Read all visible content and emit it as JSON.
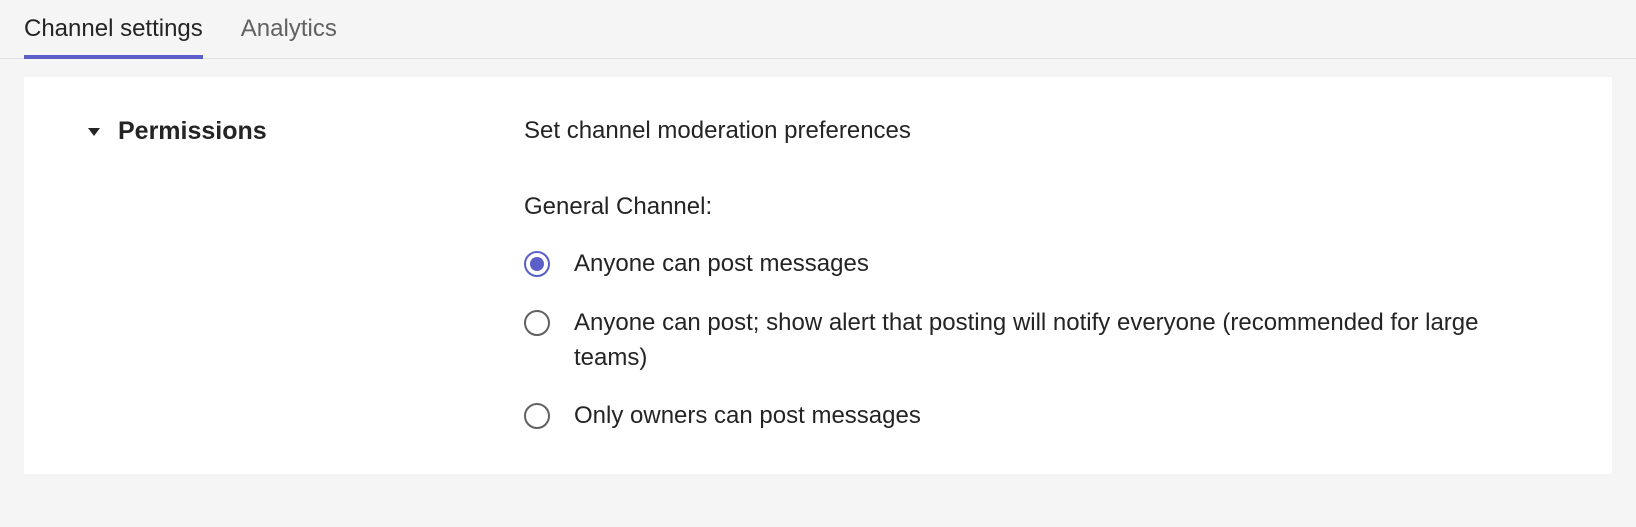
{
  "tabs": [
    {
      "label": "Channel settings",
      "active": true
    },
    {
      "label": "Analytics",
      "active": false
    }
  ],
  "section": {
    "title": "Permissions",
    "description": "Set channel moderation preferences",
    "field_label": "General Channel:",
    "options": [
      {
        "label": "Anyone can post messages",
        "selected": true
      },
      {
        "label": "Anyone can post; show alert that posting will notify everyone (recommended for large teams)",
        "selected": false
      },
      {
        "label": "Only owners can post messages",
        "selected": false
      }
    ]
  }
}
